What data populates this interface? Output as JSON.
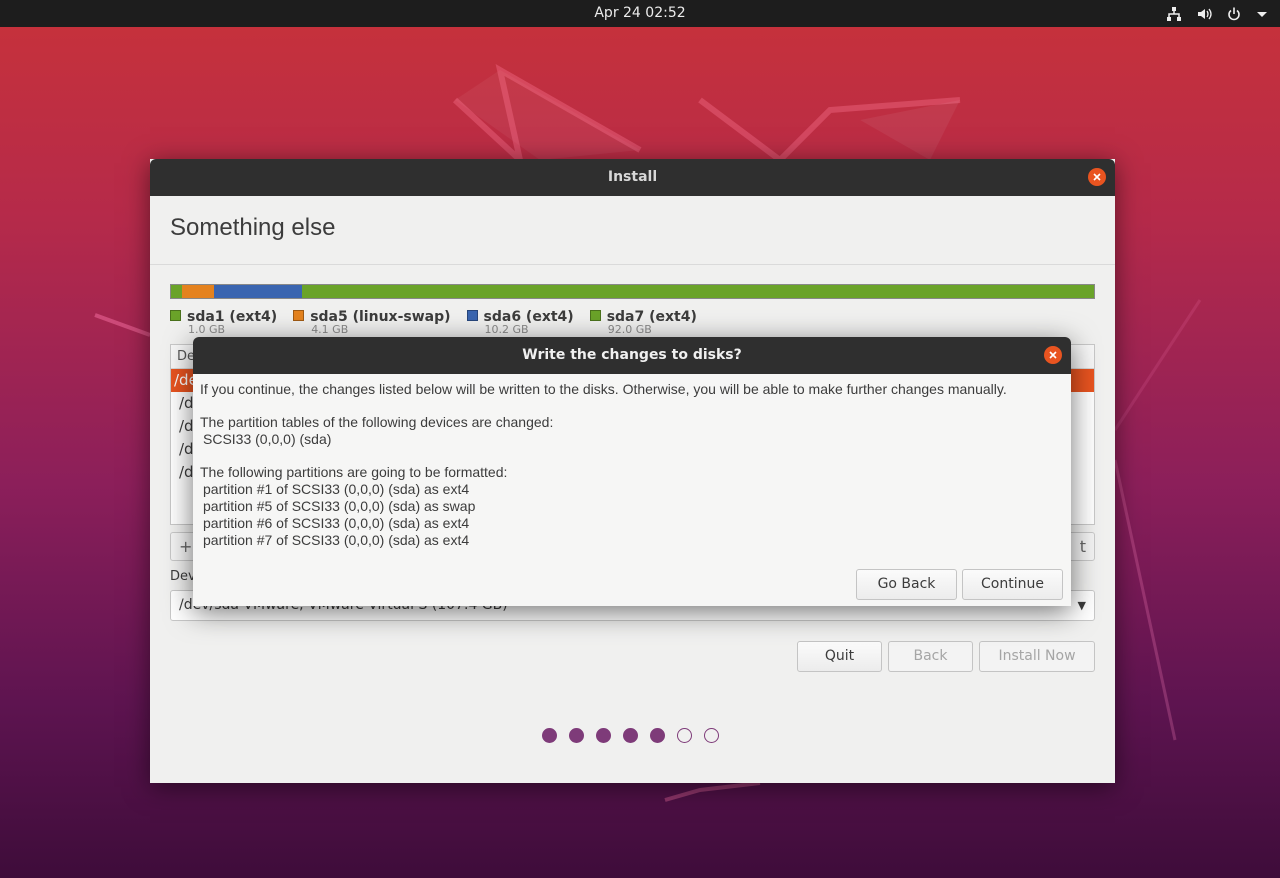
{
  "topbar": {
    "clock": "Apr 24  02:52",
    "icons": [
      "network-icon",
      "volume-icon",
      "power-icon",
      "menu-down-icon"
    ]
  },
  "install_window": {
    "title": "Install",
    "heading": "Something else",
    "partitions": [
      {
        "name": "sda1 (ext4)",
        "size": "1.0 GB",
        "color": "#6aa329"
      },
      {
        "name": "sda5 (linux-swap)",
        "size": "4.1 GB",
        "color": "#e4821e"
      },
      {
        "name": "sda6 (ext4)",
        "size": "10.2 GB",
        "color": "#3a65b0"
      },
      {
        "name": "sda7 (ext4)",
        "size": "92.0 GB",
        "color": "#6aa329"
      }
    ],
    "device_list": {
      "header": "De",
      "rows": [
        "/de",
        "/d",
        "/d",
        "/d",
        "/d"
      ]
    },
    "toolbar": {
      "add": "+",
      "right": "t"
    },
    "boot_device_label": "Dev",
    "boot_device_value": "/dev/sda   VMware, VMware Virtual S (107.4 GB)",
    "buttons": {
      "quit": "Quit",
      "back": "Back",
      "install_now": "Install Now"
    },
    "progress": {
      "total_steps": 7,
      "completed_steps": 5
    }
  },
  "dialog": {
    "title": "Write the changes to disks?",
    "intro": "If you continue, the changes listed below will be written to the disks. Otherwise, you will be able to make further changes manually.",
    "tables_heading": "The partition tables of the following devices are changed:",
    "tables": [
      "SCSI33 (0,0,0) (sda)"
    ],
    "format_heading": "The following partitions are going to be formatted:",
    "formats": [
      "partition #1 of SCSI33 (0,0,0) (sda) as ext4",
      "partition #5 of SCSI33 (0,0,0) (sda) as swap",
      "partition #6 of SCSI33 (0,0,0) (sda) as ext4",
      "partition #7 of SCSI33 (0,0,0) (sda) as ext4"
    ],
    "buttons": {
      "go_back": "Go Back",
      "continue": "Continue"
    }
  },
  "colors": {
    "accent": "#e95420",
    "progress_dot": "#7e3b79"
  }
}
